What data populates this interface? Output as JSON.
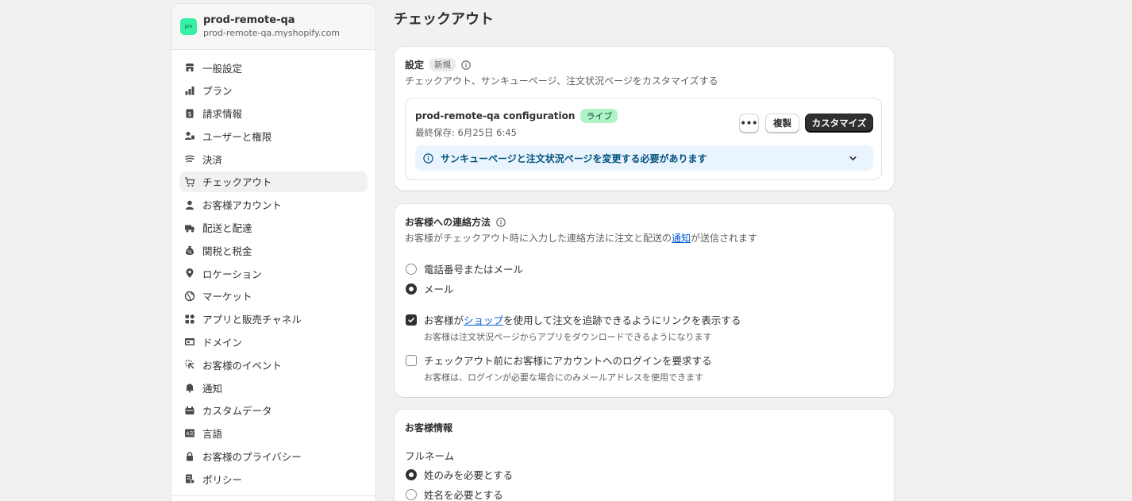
{
  "store": {
    "avatar_text": "pro",
    "name": "prod-remote-qa",
    "domain": "prod-remote-qa.myshopify.com"
  },
  "nav": [
    {
      "label": "一般設定",
      "icon": "store-icon"
    },
    {
      "label": "プラン",
      "icon": "plan-icon"
    },
    {
      "label": "請求情報",
      "icon": "billing-icon"
    },
    {
      "label": "ユーザーと権限",
      "icon": "users-icon"
    },
    {
      "label": "決済",
      "icon": "payments-icon"
    },
    {
      "label": "チェックアウト",
      "icon": "cart-icon",
      "active": true
    },
    {
      "label": "お客様アカウント",
      "icon": "person-icon"
    },
    {
      "label": "配送と配達",
      "icon": "truck-icon"
    },
    {
      "label": "関税と税金",
      "icon": "tax-icon"
    },
    {
      "label": "ロケーション",
      "icon": "location-icon"
    },
    {
      "label": "マーケット",
      "icon": "globe-icon"
    },
    {
      "label": "アプリと販売チャネル",
      "icon": "apps-icon"
    },
    {
      "label": "ドメイン",
      "icon": "domain-icon"
    },
    {
      "label": "お客様のイベント",
      "icon": "events-icon"
    },
    {
      "label": "通知",
      "icon": "bell-icon"
    },
    {
      "label": "カスタムデータ",
      "icon": "data-icon"
    },
    {
      "label": "言語",
      "icon": "language-icon"
    },
    {
      "label": "お客様のプライバシー",
      "icon": "lock-icon"
    },
    {
      "label": "ポリシー",
      "icon": "policy-icon"
    }
  ],
  "page": {
    "title": "チェックアウト"
  },
  "settings_card": {
    "title": "設定",
    "badge": "新規",
    "subtitle": "チェックアウト、サンキューページ、注文状況ページをカスタマイズする",
    "config_name": "prod-remote-qa configuration",
    "live_badge": "ライブ",
    "saved": "最終保存: 6月25日 6:45",
    "more_label": "•••",
    "duplicate_label": "複製",
    "customize_label": "カスタマイズ",
    "banner": "サンキューページと注文状況ページを変更する必要があります"
  },
  "contact_card": {
    "title": "お客様への連絡方法",
    "subtitle_pre": "お客様がチェックアウト時に入力した連絡方法に注文と配送の",
    "subtitle_link": "通知",
    "subtitle_post": "が送信されます",
    "option_phone_email": "電話番号またはメール",
    "option_email": "メール",
    "shop_pre": "お客様が",
    "shop_link": "ショップ",
    "shop_post": "を使用して注文を追跡できるようにリンクを表示する",
    "shop_help": "お客様は注文状況ページからアプリをダウンロードできるようになります",
    "login_label": "チェックアウト前にお客様にアカウントへのログインを要求する",
    "login_help": "お客様は、ログインが必要な場合にのみメールアドレスを使用できます"
  },
  "customer_card": {
    "title": "お客様情報",
    "fullname_label": "フルネーム",
    "option_last_only": "姓のみを必要とする",
    "option_full": "姓名を必要とする"
  }
}
